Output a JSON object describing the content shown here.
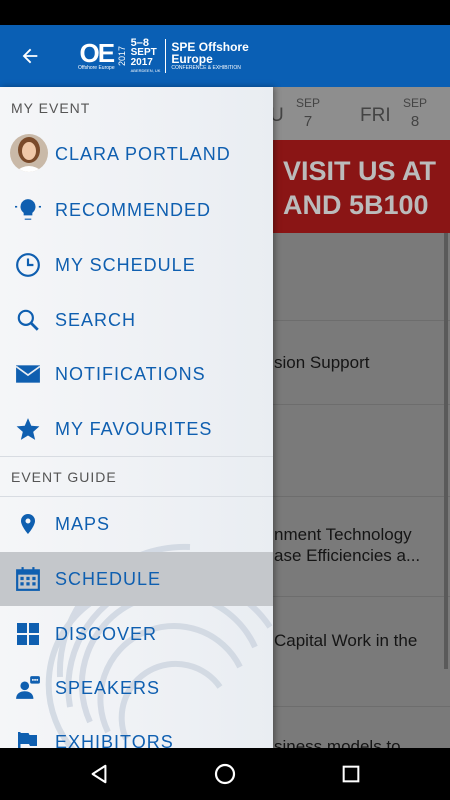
{
  "appbar": {
    "logo": {
      "oe": "OE",
      "oe_sub": "Offshore Europe",
      "year": "2017",
      "dates_line1": "5–8",
      "dates_line2": "SEPT",
      "dates_line3": "2017",
      "location": "ABERDEEN, UK",
      "name_line1": "SPE Offshore",
      "name_line2": "Europe",
      "name_line3": "CONFERENCE & EXHIBITION"
    }
  },
  "background": {
    "day_tabs": [
      {
        "dow": "U",
        "month": "SEP",
        "day": "7"
      },
      {
        "dow": "FRI",
        "month": "SEP",
        "day": "8"
      }
    ],
    "banner": {
      "line1": "VISIT US AT",
      "line2": "AND 5B100"
    },
    "rows": [
      "sion Support",
      "nment Technology",
      "ase Efficiencies a...",
      "Capital Work in the",
      "siness models to"
    ]
  },
  "drawer": {
    "sections": {
      "my_event": "MY EVENT",
      "event_guide": "EVENT GUIDE"
    },
    "items": [
      {
        "label": "CLARA PORTLAND",
        "icon": "avatar"
      },
      {
        "label": "RECOMMENDED",
        "icon": "lightbulb-icon"
      },
      {
        "label": "MY SCHEDULE",
        "icon": "clock-icon"
      },
      {
        "label": "SEARCH",
        "icon": "search-icon"
      },
      {
        "label": "NOTIFICATIONS",
        "icon": "envelope-icon"
      },
      {
        "label": "MY FAVOURITES",
        "icon": "star-icon"
      },
      {
        "label": "MAPS",
        "icon": "map-pin-icon"
      },
      {
        "label": "SCHEDULE",
        "icon": "calendar-icon"
      },
      {
        "label": "DISCOVER",
        "icon": "grid-icon"
      },
      {
        "label": "SPEAKERS",
        "icon": "speaker-icon"
      },
      {
        "label": "EXHIBITORS",
        "icon": "flag-icon"
      }
    ],
    "active_item": "SCHEDULE"
  },
  "colors": {
    "brand_blue": "#0a5fb4",
    "item_blue": "#0f5fb0",
    "banner_red": "#8a1515",
    "active_bg": "#c4c7cb"
  }
}
